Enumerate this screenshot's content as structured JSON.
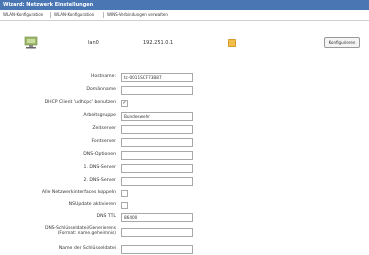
{
  "window": {
    "title": "Wizard: Netzwerk Einstellungen"
  },
  "tabs": [
    {
      "label": "WLAN-Konfiguration"
    },
    {
      "label": "WLAN-Konfiguration"
    },
    {
      "label": "WINS-Verbindungen verwalten"
    }
  ],
  "device": {
    "name": "lan0",
    "ip": "192.251.0.1",
    "configure_label": "Konfigurieren"
  },
  "form": {
    "hostname": {
      "label": "Hostname:",
      "value": "tc-0011SCF73B87"
    },
    "domain": {
      "label": "Domänname",
      "value": ""
    },
    "dhcp": {
      "label": "DHCP Client 'udhcpc' benutzen",
      "checked": "✓"
    },
    "workgroup": {
      "label": "Arbeitsgruppe",
      "value": "Bundeswehr"
    },
    "timeserver": {
      "label": "Zeitserver",
      "value": ""
    },
    "fontserver": {
      "label": "Fontserver",
      "value": ""
    },
    "dns_options": {
      "label": "DNS-Optionen",
      "value": ""
    },
    "dns1": {
      "label": "1. DNS-Server",
      "value": ""
    },
    "dns2": {
      "label": "2. DNS-Server",
      "value": ""
    },
    "bridge": {
      "label": "Alle Netzwerkinterfaces koppeln",
      "checked": ""
    },
    "nsupdate": {
      "label": "NSUpdate aktivieren",
      "checked": ""
    },
    "dns_ttl": {
      "label": "DNS TTL",
      "value": "86400"
    },
    "dns_key": {
      "label_line1": "DNS-Schlüsseldatei/Generierens",
      "label_line2": "(Format: name.geheimnis)",
      "value": ""
    },
    "key_name": {
      "label": "Name der Schlüsseldatei",
      "value": ""
    }
  }
}
